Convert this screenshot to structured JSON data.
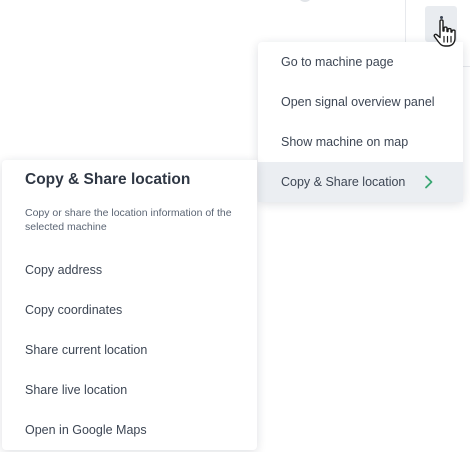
{
  "menu": {
    "items": [
      {
        "label": "Go to machine page"
      },
      {
        "label": "Open signal overview panel"
      },
      {
        "label": "Show machine on map"
      },
      {
        "label": "Copy & Share location",
        "active": true
      }
    ],
    "chevron_color": "#3aa673"
  },
  "submenu": {
    "title": "Copy & Share location",
    "description": "Copy or share the location information of the selected machine",
    "items": [
      {
        "label": "Copy address"
      },
      {
        "label": "Copy coordinates"
      },
      {
        "label": "Share current location"
      },
      {
        "label": "Share live location"
      },
      {
        "label": "Open in Google Maps"
      }
    ]
  },
  "icons": {
    "more_button": "kebab-vertical-icon",
    "cursor": "hand-pointer-icon",
    "submenu_arrow": "chevron-right-icon"
  }
}
